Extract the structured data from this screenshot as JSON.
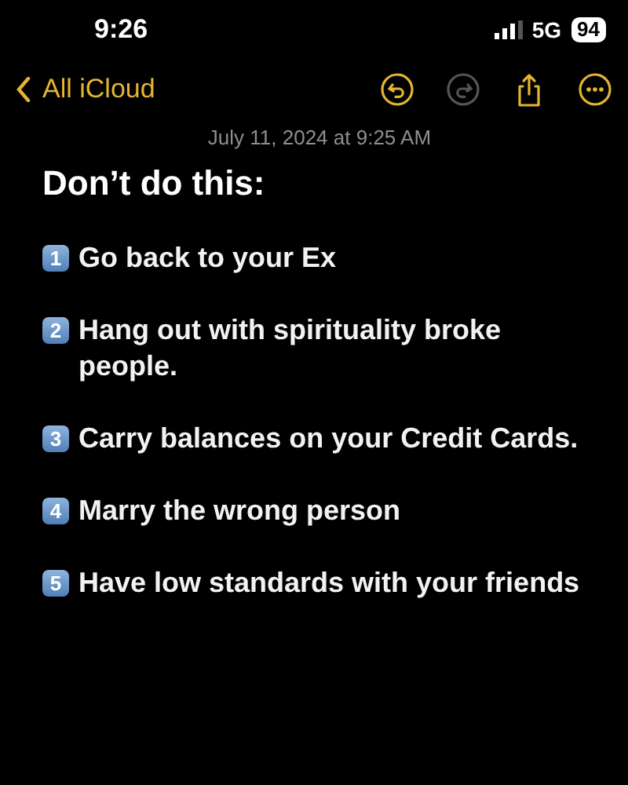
{
  "status_bar": {
    "time": "9:26",
    "network": "5G",
    "battery": "94"
  },
  "nav": {
    "back_label": "All iCloud",
    "actions": [
      {
        "kind": "undo",
        "disabled": false
      },
      {
        "kind": "redo",
        "disabled": true
      },
      {
        "kind": "share",
        "disabled": false
      },
      {
        "kind": "more",
        "disabled": false
      }
    ]
  },
  "note": {
    "date": "July 11, 2024 at 9:25 AM",
    "heading": "Don’t do this:",
    "items": [
      {
        "number": "1",
        "text": "Go back to your Ex"
      },
      {
        "number": "2",
        "text": "Hang out with spirituality broke people."
      },
      {
        "number": "3",
        "text": "Carry balances on your Credit Cards."
      },
      {
        "number": "4",
        "text": "Marry the wrong person"
      },
      {
        "number": "5",
        "text": "Have low standards with your friends"
      }
    ]
  }
}
